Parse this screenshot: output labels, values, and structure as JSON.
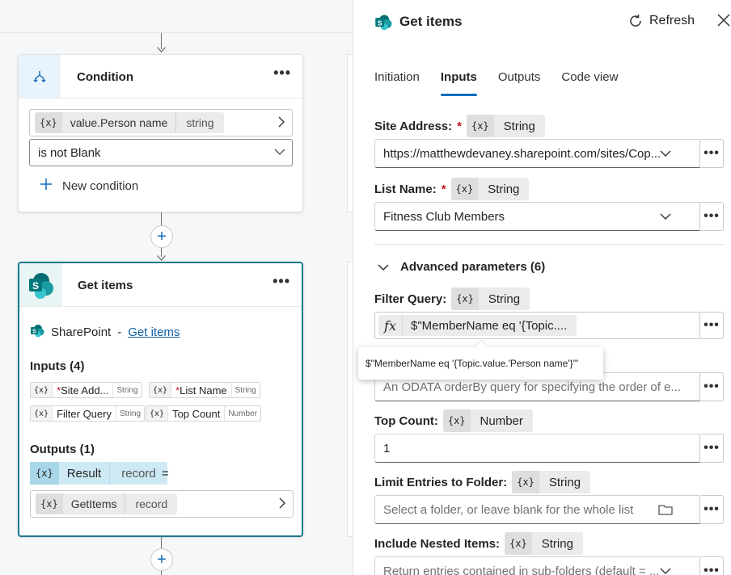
{
  "canvas": {
    "condition": {
      "title": "Condition",
      "more": "•••",
      "variable": {
        "icon": "{x}",
        "name": "value.Person name",
        "type": "string"
      },
      "operator": "is not Blank",
      "new_condition": "New condition"
    },
    "get_items": {
      "title": "Get items",
      "more": "•••",
      "connector": "SharePoint",
      "separator": " - ",
      "action_link": "Get items",
      "inputs_label": "Inputs (4)",
      "inputs": [
        {
          "icon": "{x}",
          "required": "*",
          "name": "Site Add...",
          "type": "String"
        },
        {
          "icon": "{x}",
          "required": "*",
          "name": "List Name",
          "type": "String"
        },
        {
          "icon": "{x}",
          "required": "",
          "name": "Filter Query",
          "type": "String"
        },
        {
          "icon": "{x}",
          "required": "",
          "name": "Top Count",
          "type": "Number"
        }
      ],
      "outputs_label": "Outputs (1)",
      "result": {
        "icon": "{x}",
        "name": "Result",
        "type": "record",
        "equals": "="
      },
      "value": {
        "icon": "{x}",
        "name": "GetItems",
        "type": "record"
      }
    }
  },
  "panel": {
    "title": "Get items",
    "refresh_label": "Refresh",
    "tabs": [
      "Initiation",
      "Inputs",
      "Outputs",
      "Code view"
    ],
    "active_tab": "Inputs",
    "fields": {
      "site_address": {
        "label": "Site Address:",
        "required": "*",
        "type": "String",
        "value": "https://matthewdevaney.sharepoint.com/sites/Cop..."
      },
      "list_name": {
        "label": "List Name:",
        "required": "*",
        "type": "String",
        "value": "Fitness Club Members"
      },
      "advanced": "Advanced parameters (6)",
      "filter_query": {
        "label": "Filter Query:",
        "type": "String",
        "icon": "fx",
        "value": "$\"MemberName eq '{Topic...."
      },
      "tooltip": "$\"MemberName eq '{Topic.value.'Person name'}'\"",
      "order_by": {
        "placeholder": "An ODATA orderBy query for specifying the order of e..."
      },
      "top_count": {
        "label": "Top Count:",
        "type": "Number",
        "value": "1"
      },
      "limit_folder": {
        "label": "Limit Entries to Folder:",
        "type": "String",
        "placeholder": "Select a folder, or leave blank for the whole list"
      },
      "nested": {
        "label": "Include Nested Items:",
        "type": "String",
        "placeholder": "Return entries contained in sub-folders (default = ..."
      }
    },
    "more": "•••",
    "var_icon": "{x}"
  },
  "colors": {
    "accent": "#0f6cbd",
    "selected_border": "#1b7a8c",
    "result_chip": "#cde9f3",
    "sharepoint": "#038387"
  }
}
